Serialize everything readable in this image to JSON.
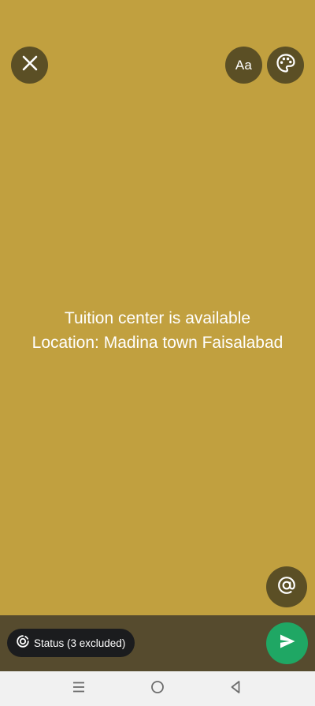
{
  "colors": {
    "canvas_bg": "#c1a03f",
    "button_bg": "#5b4f25",
    "bottom_bar_bg": "#564b2e",
    "pill_bg": "#1b1c1e",
    "send_bg": "#1fa764",
    "nav_bg": "#f1f1f1",
    "nav_icon": "#6c6c6c",
    "text": "#ffffff"
  },
  "toolbar": {
    "close_icon": "close-icon",
    "font_label": "Aa",
    "palette_icon": "palette-icon"
  },
  "status": {
    "line1": "Tuition center is available",
    "line2": "Location: Madina town Faisalabad"
  },
  "mention_icon": "at-icon",
  "bottom": {
    "audience_icon": "status-ring-icon",
    "audience_label": "Status (3 excluded)",
    "send_icon": "send-icon"
  },
  "nav": {
    "recents_icon": "recents-icon",
    "home_icon": "home-icon",
    "back_icon": "back-icon"
  }
}
